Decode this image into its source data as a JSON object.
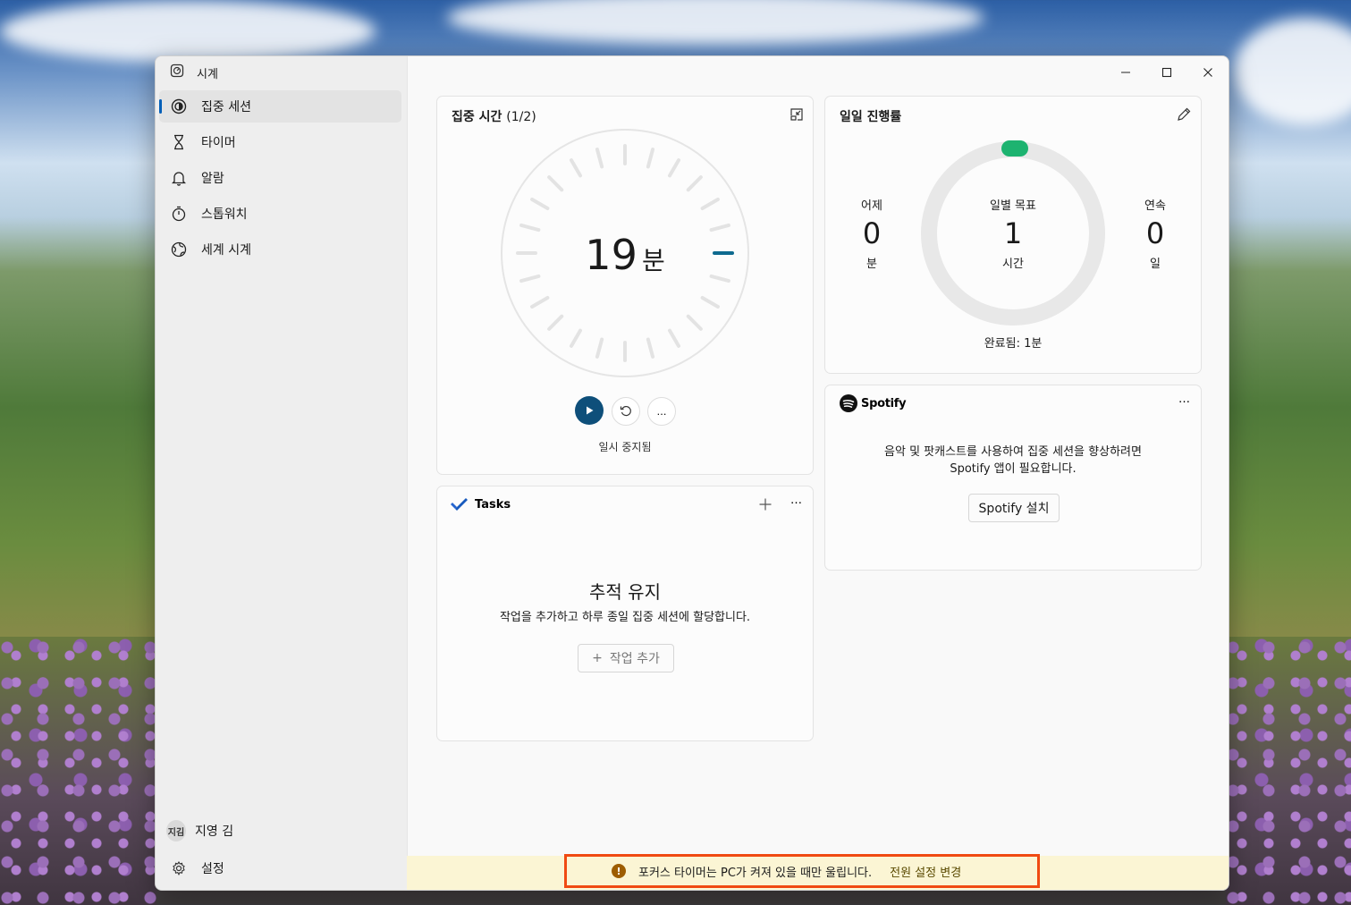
{
  "app": {
    "title": "시계"
  },
  "window_controls": {
    "minimize": "—",
    "maximize": "☐",
    "close": "✕"
  },
  "sidebar": {
    "items": [
      {
        "label": "집중 세션",
        "icon": "focus-icon"
      },
      {
        "label": "타이머",
        "icon": "hourglass-icon"
      },
      {
        "label": "알람",
        "icon": "bell-icon"
      },
      {
        "label": "스톱워치",
        "icon": "stopwatch-icon"
      },
      {
        "label": "세계 시계",
        "icon": "globe-icon"
      }
    ],
    "user": {
      "initials": "지김",
      "name": "지영 김"
    },
    "settings": "설정"
  },
  "focus": {
    "title": "집중 시간",
    "count": "(1/2)",
    "minutes": "19",
    "unit": "분",
    "status": "일시 중지됨",
    "more": "…"
  },
  "progress": {
    "title": "일일 진행률",
    "yesterday": {
      "label": "어제",
      "value": "0",
      "unit": "분"
    },
    "goal": {
      "label": "일별 목표",
      "value": "1",
      "unit": "시간"
    },
    "streak": {
      "label": "연속",
      "value": "0",
      "unit": "일"
    },
    "completed": "완료됨: 1분",
    "accent": "#1db370"
  },
  "spotify": {
    "brand": "Spotify",
    "message_line1": "음악 및 팟캐스트를 사용하여 집중 세션을 향상하려면",
    "message_line2": "Spotify 앱이 필요합니다.",
    "install": "Spotify 설치",
    "more": "…"
  },
  "tasks": {
    "title": "Tasks",
    "heading": "추적 유지",
    "description": "작업을 추가하고 하루 종일 집중 세션에 할당합니다.",
    "add_button": "작업 추가",
    "add_icon": "+",
    "more": "…"
  },
  "banner": {
    "message": "포커스 타이머는 PC가 켜져 있을 때만 울립니다.",
    "link": "전원 설정 변경"
  }
}
